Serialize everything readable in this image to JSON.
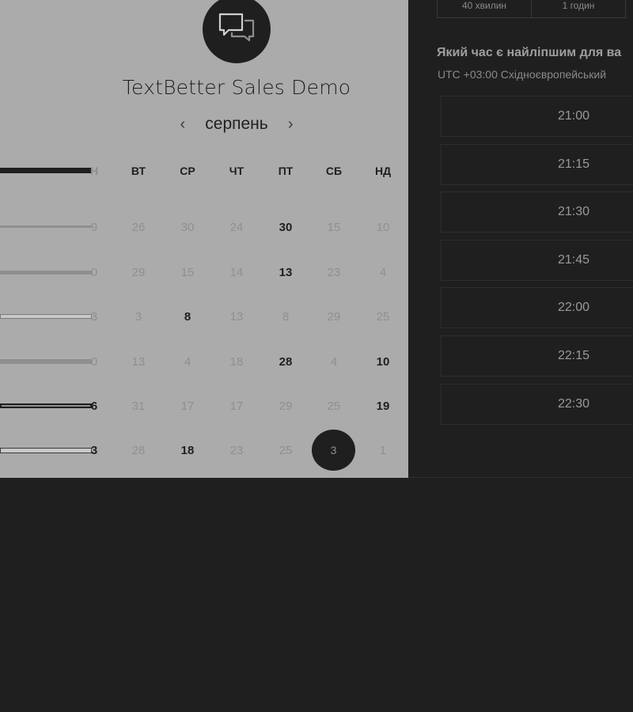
{
  "event": {
    "title": "TextBetter Sales Demo",
    "logo_icon": "chat-bubbles-icon"
  },
  "calendar": {
    "month": "серпень",
    "prev_icon": "chevron-left-icon",
    "next_icon": "chevron-right-icon",
    "weekdays": [
      "Н",
      "ВТ",
      "СР",
      "ЧТ",
      "ПТ",
      "СБ",
      "НД"
    ],
    "rows": [
      [
        "9",
        "26",
        "30",
        "24",
        "30",
        "15",
        "10"
      ],
      [
        "0",
        "29",
        "15",
        "14",
        "13",
        "23",
        "4"
      ],
      [
        "3",
        "3",
        "8",
        "13",
        "8",
        "29",
        "25"
      ],
      [
        "0",
        "13",
        "4",
        "18",
        "28",
        "4",
        "10"
      ],
      [
        "6",
        "31",
        "17",
        "17",
        "29",
        "25",
        "19"
      ],
      [
        "3",
        "28",
        "18",
        "23",
        "25",
        "3",
        "1"
      ]
    ]
  },
  "durations": [
    "40 хвилин",
    "1 годин"
  ],
  "question": "Який час є найліпшим для ва",
  "timezone": "UTC +03:00 Східноєвропейський",
  "slots": [
    "21:00",
    "21:15",
    "21:30",
    "21:45",
    "22:00",
    "22:15",
    "22:30"
  ],
  "colors": {
    "page_bg": "#1f1f1f",
    "panel_bg": "#ababab",
    "selected_bg": "#1f1f1f"
  }
}
